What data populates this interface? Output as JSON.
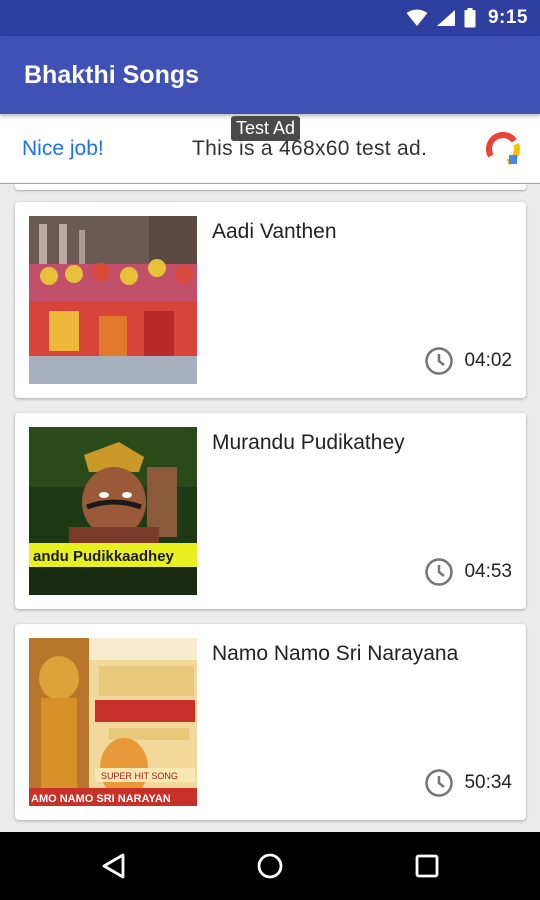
{
  "status_bar": {
    "time": "9:15"
  },
  "app_bar": {
    "title": "Bhakthi Songs"
  },
  "ad": {
    "tag": "Test Ad",
    "left_text": "Nice job!",
    "text": "This is a 468x60 test ad."
  },
  "songs": [
    {
      "title": "Aadi Vanthen",
      "duration": "04:02"
    },
    {
      "title": "Murandu Pudikathey",
      "duration": "04:53",
      "caption": "andu Pudikkaadhey"
    },
    {
      "title": "Namo Namo Sri Narayana",
      "duration": "50:34",
      "caption": "AMO NAMO SRI NARAYAN",
      "banner": "SUPER HIT SONG"
    }
  ],
  "icons": {
    "wifi": "wifi-icon",
    "signal": "signal-icon",
    "battery": "battery-icon",
    "clock": "clock-icon",
    "back": "back-icon",
    "home": "home-icon",
    "recents": "recents-icon"
  },
  "colors": {
    "primary": "#3f51b5",
    "primary_dark": "#2f3f9f",
    "ad_link": "#1a73e8",
    "background": "#ececec"
  }
}
